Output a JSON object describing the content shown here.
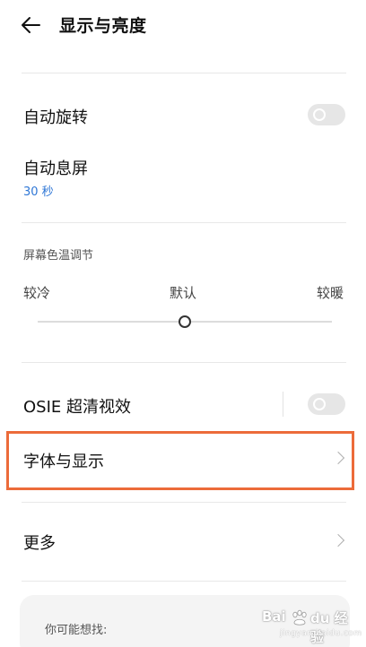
{
  "header": {
    "back_icon": "arrow-left-icon",
    "title": "显示与亮度"
  },
  "settings": {
    "auto_rotate": {
      "label": "自动旋转",
      "enabled": false
    },
    "auto_lock": {
      "label": "自动息屏",
      "value": "30 秒"
    },
    "color_temperature": {
      "section_label": "屏幕色温调节",
      "cooler": "较冷",
      "default": "默认",
      "warmer": "较暖",
      "level": 0.5
    },
    "osie": {
      "label": "OSIE 超清视效",
      "enabled": false
    },
    "font_display": {
      "label": "字体与显示",
      "highlighted": true
    },
    "more": {
      "label": "更多"
    }
  },
  "suggestions": {
    "label": "你可能想找:"
  },
  "watermark": {
    "text": "Bai du 经验",
    "url": "jingyan.baidu.com"
  },
  "colors": {
    "accent_blue": "#2f77d6",
    "highlight_border": "#ec6b3a",
    "toggle_off": "#e6e6e6"
  }
}
